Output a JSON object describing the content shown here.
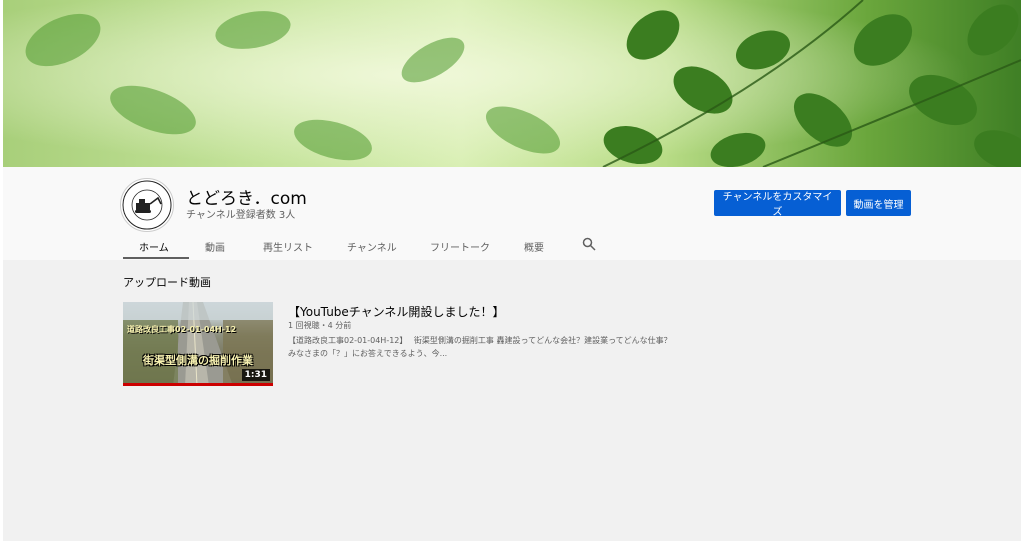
{
  "channel": {
    "name": "とどろき．com",
    "subscribers": "チャンネル登録者数 3人",
    "avatar_ring_text": "TODOROKI KENSETSU"
  },
  "buttons": {
    "customize": "チャンネルをカスタマイズ",
    "manage_videos": "動画を管理"
  },
  "tabs": [
    {
      "label": "ホーム",
      "active": true
    },
    {
      "label": "動画",
      "active": false
    },
    {
      "label": "再生リスト",
      "active": false
    },
    {
      "label": "チャンネル",
      "active": false
    },
    {
      "label": "フリートーク",
      "active": false
    },
    {
      "label": "概要",
      "active": false
    }
  ],
  "search_icon": "search-icon",
  "uploads": {
    "section_title": "アップロード動画",
    "video": {
      "title": "【YouTubeチャンネル開設しました！】",
      "meta": "1 回視聴・4 分前",
      "description_line1": "【道路改良工事02-01-04H-12】　 街渠型側溝の掘削工事 轟建設ってどんな会社？建設業ってどんな仕事？",
      "description_line2": "みなさまの「？」にお答えできるよう、今...",
      "duration": "1:31",
      "thumb_caption": "街渠型側溝の掘削作業",
      "thumb_top_text": "道路改良工事02-01-04H-12",
      "progress": 1.0
    }
  },
  "colors": {
    "accent": "#065fd4",
    "progress": "#cc0000"
  }
}
